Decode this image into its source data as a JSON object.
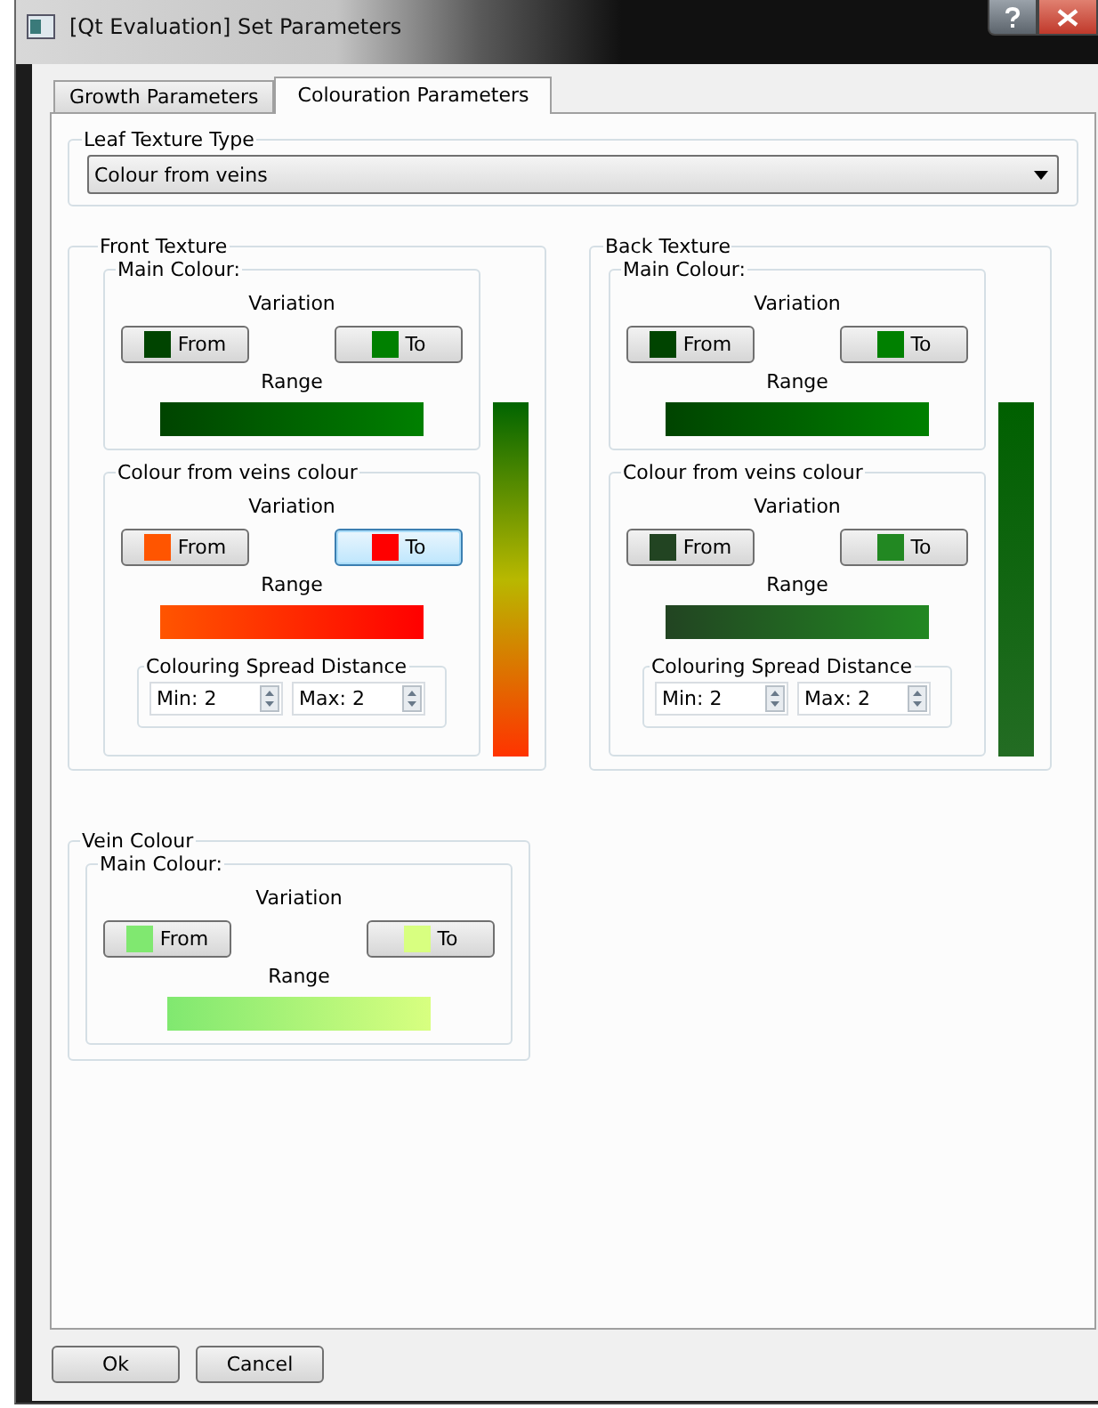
{
  "window": {
    "title": "[Qt Evaluation] Set Parameters"
  },
  "tabs": [
    {
      "label": "Growth Parameters",
      "selected": false
    },
    {
      "label": "Colouration Parameters",
      "selected": true
    }
  ],
  "leaf_texture_type": {
    "title": "Leaf Texture Type",
    "value": "Colour from veins"
  },
  "textures": [
    {
      "title": "Front Texture",
      "sections": [
        {
          "title": "Main Colour:",
          "variation_label": "Variation",
          "range_label": "Range",
          "from": {
            "label": "From",
            "color": "#004400",
            "focused": false
          },
          "to": {
            "label": "To",
            "color": "#008000",
            "focused": false
          }
        },
        {
          "title": "Colour from veins colour",
          "variation_label": "Variation",
          "range_label": "Range",
          "from": {
            "label": "From",
            "color": "#ff5500",
            "focused": false
          },
          "to": {
            "label": "To",
            "color": "#ff0000",
            "focused": true
          },
          "spread": {
            "title": "Colouring Spread Distance",
            "min": "Min: 2",
            "max": "Max: 2"
          }
        }
      ],
      "gradient": [
        {
          "color": "#006400"
        },
        {
          "color": "#b8b800"
        },
        {
          "color": "#ff3300"
        }
      ]
    },
    {
      "title": "Back Texture",
      "sections": [
        {
          "title": "Main Colour:",
          "variation_label": "Variation",
          "range_label": "Range",
          "from": {
            "label": "From",
            "color": "#004400",
            "focused": false
          },
          "to": {
            "label": "To",
            "color": "#008000",
            "focused": false
          }
        },
        {
          "title": "Colour from veins colour",
          "variation_label": "Variation",
          "range_label": "Range",
          "from": {
            "label": "From",
            "color": "#224422",
            "focused": false
          },
          "to": {
            "label": "To",
            "color": "#228822",
            "focused": false
          },
          "spread": {
            "title": "Colouring Spread Distance",
            "min": "Min: 2",
            "max": "Max: 2"
          }
        }
      ],
      "gradient": [
        {
          "color": "#006000"
        },
        {
          "color": "#236c23"
        }
      ]
    }
  ],
  "vein_colour": {
    "title": "Vein Colour",
    "sections": [
      {
        "title": "Main Colour:",
        "variation_label": "Variation",
        "range_label": "Range",
        "from": {
          "label": "From",
          "color": "#80e870",
          "focused": false
        },
        "to": {
          "label": "To",
          "color": "#d8ff80",
          "focused": false
        }
      }
    ]
  },
  "buttons": [
    {
      "label": "Ok"
    },
    {
      "label": "Cancel"
    }
  ]
}
